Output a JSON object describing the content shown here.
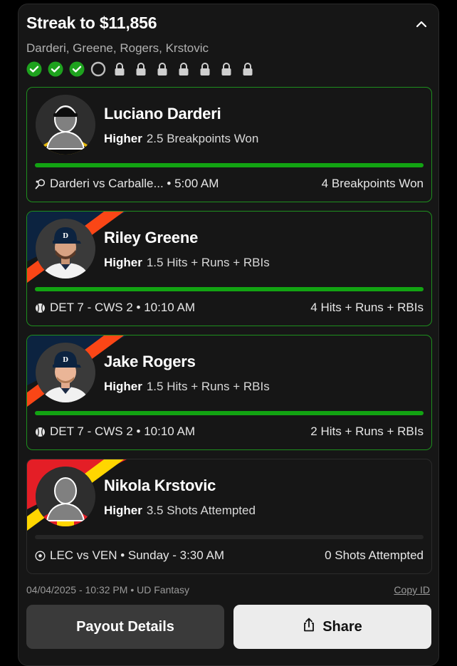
{
  "header": {
    "title": "Streak to $11,856",
    "subtitle": "Darderi, Greene, Rogers, Krstovic"
  },
  "progress": {
    "completed": 3,
    "current": 1,
    "locked": 7
  },
  "picks": [
    {
      "name": "Luciano Darderi",
      "direction": "Higher",
      "line": "2.5 Breakpoints Won",
      "match": "Darderi vs Carballe... • 5:00 AM",
      "result": "4 Breakpoints Won",
      "progress": 1.0,
      "sport_icon": "tennis-icon",
      "status": "won"
    },
    {
      "name": "Riley Greene",
      "direction": "Higher",
      "line": "1.5 Hits + Runs + RBIs",
      "match": "DET 7 - CWS 2 • 10:10 AM",
      "result": "4 Hits + Runs + RBIs",
      "progress": 1.0,
      "sport_icon": "baseball-icon",
      "status": "won"
    },
    {
      "name": "Jake Rogers",
      "direction": "Higher",
      "line": "1.5 Hits + Runs + RBIs",
      "match": "DET 7 - CWS 2 • 10:10 AM",
      "result": "2 Hits + Runs + RBIs",
      "progress": 1.0,
      "sport_icon": "baseball-icon",
      "status": "won"
    },
    {
      "name": "Nikola Krstovic",
      "direction": "Higher",
      "line": "3.5 Shots Attempted",
      "match": "LEC vs VEN • Sunday - 3:30 AM",
      "result": "0 Shots Attempted",
      "progress": 0.0,
      "sport_icon": "soccer-icon",
      "status": "pending"
    }
  ],
  "footer": {
    "timestamp": "04/04/2025 - 10:32 PM • UD Fantasy",
    "copy_id": "Copy ID"
  },
  "buttons": {
    "payout": "Payout Details",
    "share": "Share"
  },
  "colors": {
    "win_green": "#1e8f1e",
    "bar_green": "#12a312",
    "tigers_navy": "#0c2340",
    "tigers_orange": "#fa4616",
    "lecce_red": "#e41e26",
    "lecce_yellow": "#ffd600"
  }
}
